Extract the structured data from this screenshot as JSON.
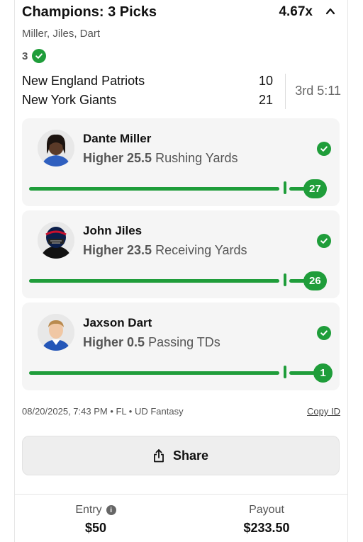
{
  "header": {
    "title": "Champions: 3 Picks",
    "multiplier": "4.67x",
    "collapse_icon": "chevron-up-icon",
    "subtitle": "Miller, Jiles, Dart",
    "correct_count": "3"
  },
  "game": {
    "teams": [
      {
        "name": "New England Patriots",
        "score": "10"
      },
      {
        "name": "New York Giants",
        "score": "21"
      }
    ],
    "status": "3rd 5:11"
  },
  "picks": [
    {
      "player": "Dante Miller",
      "direction": "Higher",
      "line": "25.5",
      "stat": "Rushing Yards",
      "result": "27",
      "status_icon": "check-circle-icon"
    },
    {
      "player": "John Jiles",
      "direction": "Higher",
      "line": "23.5",
      "stat": "Receiving Yards",
      "result": "26",
      "status_icon": "check-circle-icon"
    },
    {
      "player": "Jaxson Dart",
      "direction": "Higher",
      "line": "0.5",
      "stat": "Passing TDs",
      "result": "1",
      "status_icon": "check-circle-icon"
    }
  ],
  "meta": {
    "info": "08/20/2025, 7:43 PM • FL • UD Fantasy",
    "copy_id": "Copy ID"
  },
  "share": {
    "label": "Share",
    "icon": "share-icon"
  },
  "footer": {
    "entry_label": "Entry",
    "entry_value": "$50",
    "payout_label": "Payout",
    "payout_value": "$233.50"
  },
  "colors": {
    "accent_green": "#1f9d3a",
    "card_bg": "#f5f5f5"
  }
}
